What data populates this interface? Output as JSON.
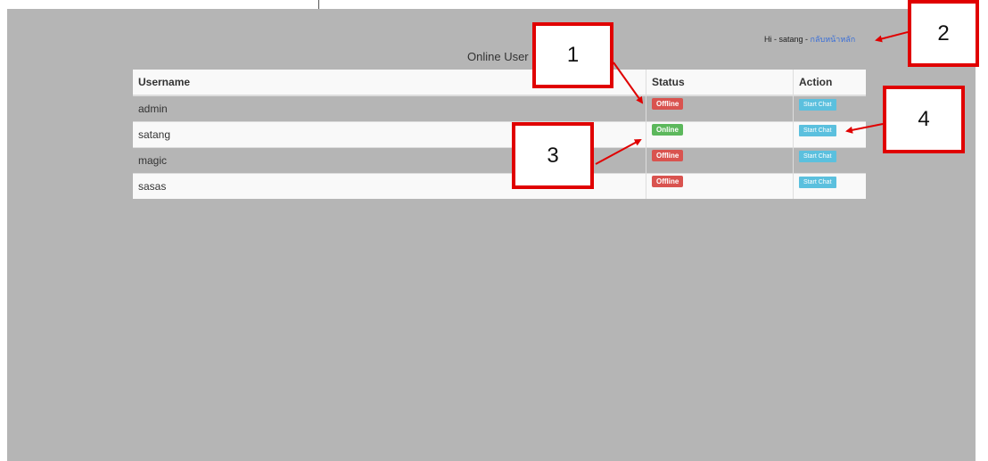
{
  "greeting": {
    "prefix": "Hi - satang - ",
    "link": "กลับหน้าหลัก"
  },
  "page_title": "Online User",
  "table": {
    "headers": [
      "Username",
      "Status",
      "Action"
    ],
    "rows": [
      {
        "username": "admin",
        "status": "Offline",
        "action": "Start Chat"
      },
      {
        "username": "satang",
        "status": "Online",
        "action": "Start Chat"
      },
      {
        "username": "magic",
        "status": "Offline",
        "action": "Start Chat"
      },
      {
        "username": "sasas",
        "status": "Offline",
        "action": "Start Chat"
      }
    ]
  },
  "callouts": [
    "1",
    "2",
    "3",
    "4"
  ],
  "colors": {
    "offline": "#d9534f",
    "online": "#5cb85c",
    "action": "#5bc0de",
    "annotation": "#e00000"
  }
}
